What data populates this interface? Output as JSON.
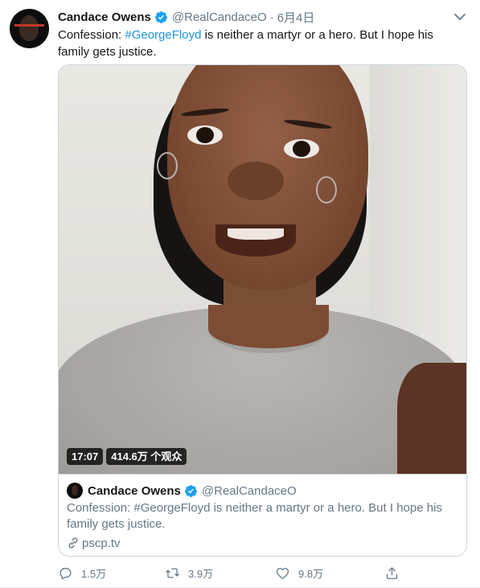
{
  "tweet": {
    "author_name": "Candace Owens",
    "author_handle": "@RealCandaceO",
    "separator": "·",
    "date": "6月4日",
    "text_before": "Confession: ",
    "hashtag": "#GeorgeFloyd",
    "text_after": " is neither a martyr or a hero. But I hope his family gets justice."
  },
  "video": {
    "duration": "17:07",
    "views": "414.6万 个观众"
  },
  "card": {
    "author_name": "Candace Owens",
    "author_handle": "@RealCandaceO",
    "text": "Confession: #GeorgeFloyd is neither a martyr or a hero. But I hope his family gets justice.",
    "link": "pscp.tv"
  },
  "actions": {
    "replies": "1.5万",
    "retweets": "3.9万",
    "likes": "9.8万"
  },
  "colors": {
    "link": "#1b95e0",
    "secondary": "#657786",
    "verified": "#1da1f2"
  },
  "icons": [
    "verified-badge-icon",
    "chevron-down-icon",
    "link-icon",
    "reply-icon",
    "retweet-icon",
    "like-icon",
    "share-icon"
  ]
}
